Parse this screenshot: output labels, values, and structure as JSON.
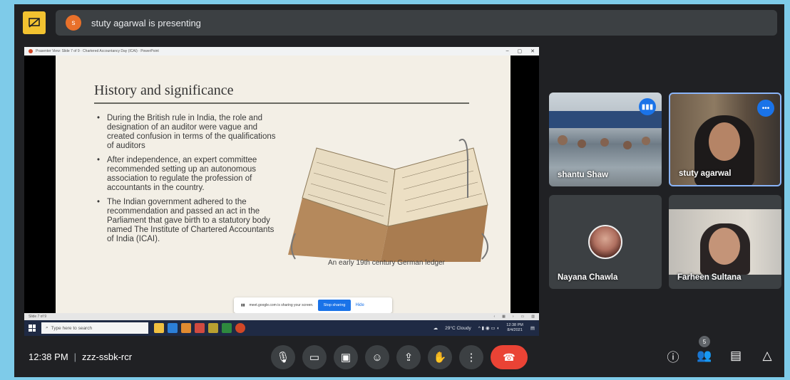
{
  "top_bar": {
    "presenter_initial": "s",
    "presenting_text": "stuty agarwal is presenting"
  },
  "shared_screen": {
    "browser_title": "Prasenter View: Slide 7 of 9 · Chartered Accountancy Day (ICAI) · PowerPoint",
    "slide": {
      "title": "History and significance",
      "bullets": [
        "During the British rule in India, the role and designation of an auditor were vague and created confusion in terms of the qualifications of auditors",
        "After independence, an expert committee recommended setting up an autonomous association to regulate the profession of accountants in the country.",
        "The Indian government adhered to the recommendation and passed an act in the Parliament that gave birth to a statutory body named The Institute of Chartered Accountants of India (ICAI)."
      ],
      "image_caption": "An early 19th century German ledger"
    },
    "share_notice": {
      "text": "meet.google.com is sharing your screen.",
      "stop_label": "Stop sharing",
      "hide_label": "Hide"
    },
    "ppt_status_left": "Slide 7 of 9",
    "taskbar": {
      "search_placeholder": "Type here to search",
      "weather": "29°C Cloudy",
      "time": "12:38 PM",
      "date": "8/4/2021"
    }
  },
  "participants": [
    {
      "name": "shantu Shaw"
    },
    {
      "name": "stuty agarwal"
    },
    {
      "name": "Nayana Chawla"
    },
    {
      "name": "Farheen Sultana"
    }
  ],
  "bottom_bar": {
    "time": "12:38 PM",
    "separator": "|",
    "meeting_code": "zzz-ssbk-rcr",
    "participant_count": "5"
  }
}
